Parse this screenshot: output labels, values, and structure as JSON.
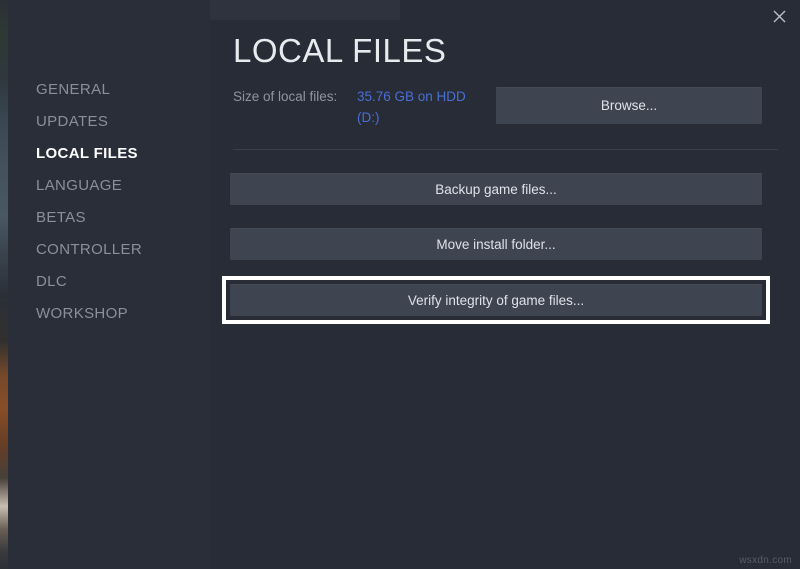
{
  "window": {
    "title": "LOCAL FILES",
    "close_label": "✕",
    "watermark": "wsxdn.com"
  },
  "sidebar": {
    "items": [
      {
        "label": "GENERAL",
        "active": false
      },
      {
        "label": "UPDATES",
        "active": false
      },
      {
        "label": "LOCAL FILES",
        "active": true
      },
      {
        "label": "LANGUAGE",
        "active": false
      },
      {
        "label": "BETAS",
        "active": false
      },
      {
        "label": "CONTROLLER",
        "active": false
      },
      {
        "label": "DLC",
        "active": false
      },
      {
        "label": "WORKSHOP",
        "active": false
      }
    ]
  },
  "main": {
    "size_row": {
      "label": "Size of local files:",
      "value": "35.76 GB on HDD (D:)"
    },
    "browse_button": "Browse...",
    "actions": [
      {
        "label": "Backup game files...",
        "highlighted": false
      },
      {
        "label": "Move install folder...",
        "highlighted": false
      },
      {
        "label": "Verify integrity of game files...",
        "highlighted": true
      }
    ]
  },
  "colors": {
    "content_bg": "#272c36",
    "sidebar_bg": "#2a2e38",
    "button_bg": "#3e4450",
    "accent_link": "#4a6fd4",
    "highlight_ring": "#ffffff",
    "text_primary": "#e8eaee",
    "text_muted": "#8a909b"
  }
}
